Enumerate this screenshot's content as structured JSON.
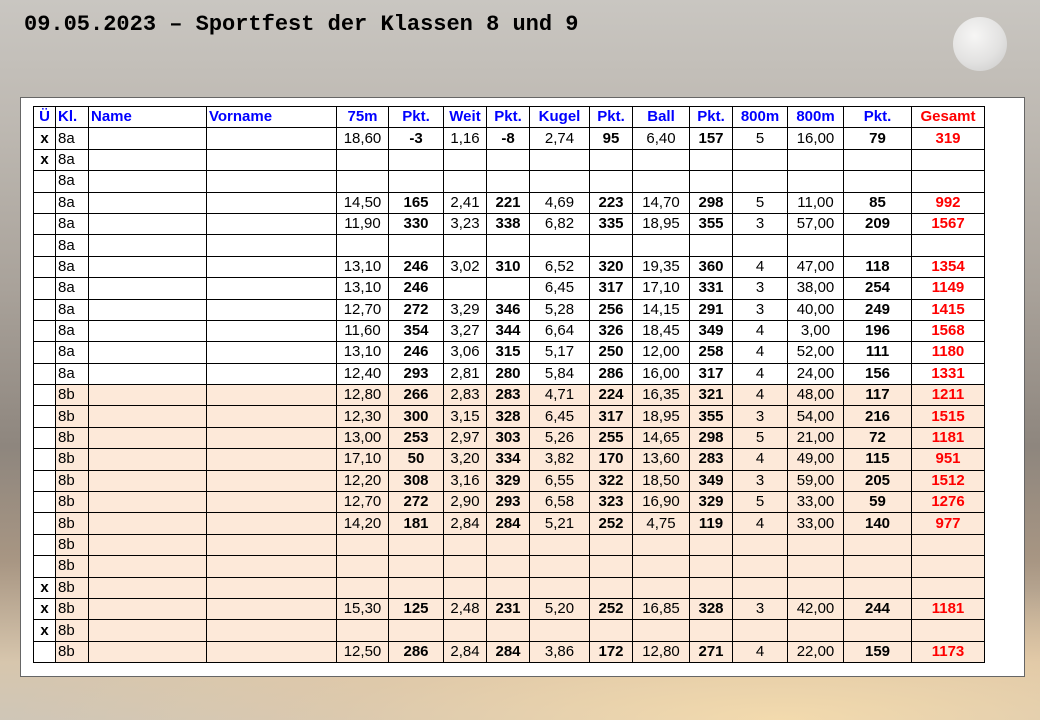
{
  "title": "09.05.2023 – Sportfest der Klassen 8 und 9",
  "colors": {
    "header_text": "#0000ff",
    "total_text": "#ff0000",
    "class_8b_fill": "#fde9d9"
  },
  "table": {
    "headers": [
      "Ü",
      "Kl.",
      "Name",
      "Vorname",
      "75m",
      "Pkt.",
      "Weit",
      "Pkt.",
      "Kugel",
      "Pkt.",
      "Ball",
      "Pkt.",
      "800m",
      "800m",
      "Pkt.",
      "Gesamt"
    ],
    "rows": [
      {
        "u": "x",
        "kl": "8a",
        "name": "",
        "vorname": "",
        "m75": "18,60",
        "p75": "-3",
        "weit": "1,16",
        "pweit": "-8",
        "kugel": "2,74",
        "pkugel": "95",
        "ball": "6,40",
        "pball": "157",
        "min": "5",
        "sec": "16,00",
        "p800": "79",
        "gesamt": "319"
      },
      {
        "u": "x",
        "kl": "8a",
        "name": "",
        "vorname": "",
        "m75": "",
        "p75": "",
        "weit": "",
        "pweit": "",
        "kugel": "",
        "pkugel": "",
        "ball": "",
        "pball": "",
        "min": "",
        "sec": "",
        "p800": "",
        "gesamt": ""
      },
      {
        "u": "",
        "kl": "8a",
        "name": "",
        "vorname": "",
        "m75": "",
        "p75": "",
        "weit": "",
        "pweit": "",
        "kugel": "",
        "pkugel": "",
        "ball": "",
        "pball": "",
        "min": "",
        "sec": "",
        "p800": "",
        "gesamt": ""
      },
      {
        "u": "",
        "kl": "8a",
        "name": "",
        "vorname": "",
        "m75": "14,50",
        "p75": "165",
        "weit": "2,41",
        "pweit": "221",
        "kugel": "4,69",
        "pkugel": "223",
        "ball": "14,70",
        "pball": "298",
        "min": "5",
        "sec": "11,00",
        "p800": "85",
        "gesamt": "992"
      },
      {
        "u": "",
        "kl": "8a",
        "name": "",
        "vorname": "",
        "m75": "11,90",
        "p75": "330",
        "weit": "3,23",
        "pweit": "338",
        "kugel": "6,82",
        "pkugel": "335",
        "ball": "18,95",
        "pball": "355",
        "min": "3",
        "sec": "57,00",
        "p800": "209",
        "gesamt": "1567"
      },
      {
        "u": "",
        "kl": "8a",
        "name": "",
        "vorname": "",
        "m75": "",
        "p75": "",
        "weit": "",
        "pweit": "",
        "kugel": "",
        "pkugel": "",
        "ball": "",
        "pball": "",
        "min": "",
        "sec": "",
        "p800": "",
        "gesamt": ""
      },
      {
        "u": "",
        "kl": "8a",
        "name": "",
        "vorname": "",
        "m75": "13,10",
        "p75": "246",
        "weit": "3,02",
        "pweit": "310",
        "kugel": "6,52",
        "pkugel": "320",
        "ball": "19,35",
        "pball": "360",
        "min": "4",
        "sec": "47,00",
        "p800": "118",
        "gesamt": "1354"
      },
      {
        "u": "",
        "kl": "8a",
        "name": "",
        "vorname": "",
        "m75": "13,10",
        "p75": "246",
        "weit": "",
        "pweit": "",
        "kugel": "6,45",
        "pkugel": "317",
        "ball": "17,10",
        "pball": "331",
        "min": "3",
        "sec": "38,00",
        "p800": "254",
        "gesamt": "1149"
      },
      {
        "u": "",
        "kl": "8a",
        "name": "",
        "vorname": "",
        "m75": "12,70",
        "p75": "272",
        "weit": "3,29",
        "pweit": "346",
        "kugel": "5,28",
        "pkugel": "256",
        "ball": "14,15",
        "pball": "291",
        "min": "3",
        "sec": "40,00",
        "p800": "249",
        "gesamt": "1415"
      },
      {
        "u": "",
        "kl": "8a",
        "name": "",
        "vorname": "",
        "m75": "11,60",
        "p75": "354",
        "weit": "3,27",
        "pweit": "344",
        "kugel": "6,64",
        "pkugel": "326",
        "ball": "18,45",
        "pball": "349",
        "min": "4",
        "sec": "3,00",
        "p800": "196",
        "gesamt": "1568"
      },
      {
        "u": "",
        "kl": "8a",
        "name": "",
        "vorname": "",
        "m75": "13,10",
        "p75": "246",
        "weit": "3,06",
        "pweit": "315",
        "kugel": "5,17",
        "pkugel": "250",
        "ball": "12,00",
        "pball": "258",
        "min": "4",
        "sec": "52,00",
        "p800": "111",
        "gesamt": "1180"
      },
      {
        "u": "",
        "kl": "8a",
        "name": "",
        "vorname": "",
        "m75": "12,40",
        "p75": "293",
        "weit": "2,81",
        "pweit": "280",
        "kugel": "5,84",
        "pkugel": "286",
        "ball": "16,00",
        "pball": "317",
        "min": "4",
        "sec": "24,00",
        "p800": "156",
        "gesamt": "1331"
      },
      {
        "u": "",
        "kl": "8b",
        "name": "",
        "vorname": "",
        "m75": "12,80",
        "p75": "266",
        "weit": "2,83",
        "pweit": "283",
        "kugel": "4,71",
        "pkugel": "224",
        "ball": "16,35",
        "pball": "321",
        "min": "4",
        "sec": "48,00",
        "p800": "117",
        "gesamt": "1211"
      },
      {
        "u": "",
        "kl": "8b",
        "name": "",
        "vorname": "",
        "m75": "12,30",
        "p75": "300",
        "weit": "3,15",
        "pweit": "328",
        "kugel": "6,45",
        "pkugel": "317",
        "ball": "18,95",
        "pball": "355",
        "min": "3",
        "sec": "54,00",
        "p800": "216",
        "gesamt": "1515"
      },
      {
        "u": "",
        "kl": "8b",
        "name": "",
        "vorname": "",
        "m75": "13,00",
        "p75": "253",
        "weit": "2,97",
        "pweit": "303",
        "kugel": "5,26",
        "pkugel": "255",
        "ball": "14,65",
        "pball": "298",
        "min": "5",
        "sec": "21,00",
        "p800": "72",
        "gesamt": "1181"
      },
      {
        "u": "",
        "kl": "8b",
        "name": "",
        "vorname": "",
        "m75": "17,10",
        "p75": "50",
        "weit": "3,20",
        "pweit": "334",
        "kugel": "3,82",
        "pkugel": "170",
        "ball": "13,60",
        "pball": "283",
        "min": "4",
        "sec": "49,00",
        "p800": "115",
        "gesamt": "951"
      },
      {
        "u": "",
        "kl": "8b",
        "name": "",
        "vorname": "",
        "m75": "12,20",
        "p75": "308",
        "weit": "3,16",
        "pweit": "329",
        "kugel": "6,55",
        "pkugel": "322",
        "ball": "18,50",
        "pball": "349",
        "min": "3",
        "sec": "59,00",
        "p800": "205",
        "gesamt": "1512"
      },
      {
        "u": "",
        "kl": "8b",
        "name": "",
        "vorname": "",
        "m75": "12,70",
        "p75": "272",
        "weit": "2,90",
        "pweit": "293",
        "kugel": "6,58",
        "pkugel": "323",
        "ball": "16,90",
        "pball": "329",
        "min": "5",
        "sec": "33,00",
        "p800": "59",
        "gesamt": "1276"
      },
      {
        "u": "",
        "kl": "8b",
        "name": "",
        "vorname": "",
        "m75": "14,20",
        "p75": "181",
        "weit": "2,84",
        "pweit": "284",
        "kugel": "5,21",
        "pkugel": "252",
        "ball": "4,75",
        "pball": "119",
        "min": "4",
        "sec": "33,00",
        "p800": "140",
        "gesamt": "977"
      },
      {
        "u": "",
        "kl": "8b",
        "name": "",
        "vorname": "",
        "m75": "",
        "p75": "",
        "weit": "",
        "pweit": "",
        "kugel": "",
        "pkugel": "",
        "ball": "",
        "pball": "",
        "min": "",
        "sec": "",
        "p800": "",
        "gesamt": ""
      },
      {
        "u": "",
        "kl": "8b",
        "name": "",
        "vorname": "",
        "m75": "",
        "p75": "",
        "weit": "",
        "pweit": "",
        "kugel": "",
        "pkugel": "",
        "ball": "",
        "pball": "",
        "min": "",
        "sec": "",
        "p800": "",
        "gesamt": ""
      },
      {
        "u": "x",
        "kl": "8b",
        "name": "",
        "vorname": "",
        "m75": "",
        "p75": "",
        "weit": "",
        "pweit": "",
        "kugel": "",
        "pkugel": "",
        "ball": "",
        "pball": "",
        "min": "",
        "sec": "",
        "p800": "",
        "gesamt": ""
      },
      {
        "u": "x",
        "kl": "8b",
        "name": "",
        "vorname": "",
        "m75": "15,30",
        "p75": "125",
        "weit": "2,48",
        "pweit": "231",
        "kugel": "5,20",
        "pkugel": "252",
        "ball": "16,85",
        "pball": "328",
        "min": "3",
        "sec": "42,00",
        "p800": "244",
        "gesamt": "1181"
      },
      {
        "u": "x",
        "kl": "8b",
        "name": "",
        "vorname": "",
        "m75": "",
        "p75": "",
        "weit": "",
        "pweit": "",
        "kugel": "",
        "pkugel": "",
        "ball": "",
        "pball": "",
        "min": "",
        "sec": "",
        "p800": "",
        "gesamt": ""
      },
      {
        "u": "",
        "kl": "8b",
        "name": "",
        "vorname": "",
        "m75": "12,50",
        "p75": "286",
        "weit": "2,84",
        "pweit": "284",
        "kugel": "3,86",
        "pkugel": "172",
        "ball": "12,80",
        "pball": "271",
        "min": "4",
        "sec": "22,00",
        "p800": "159",
        "gesamt": "1173"
      }
    ]
  }
}
